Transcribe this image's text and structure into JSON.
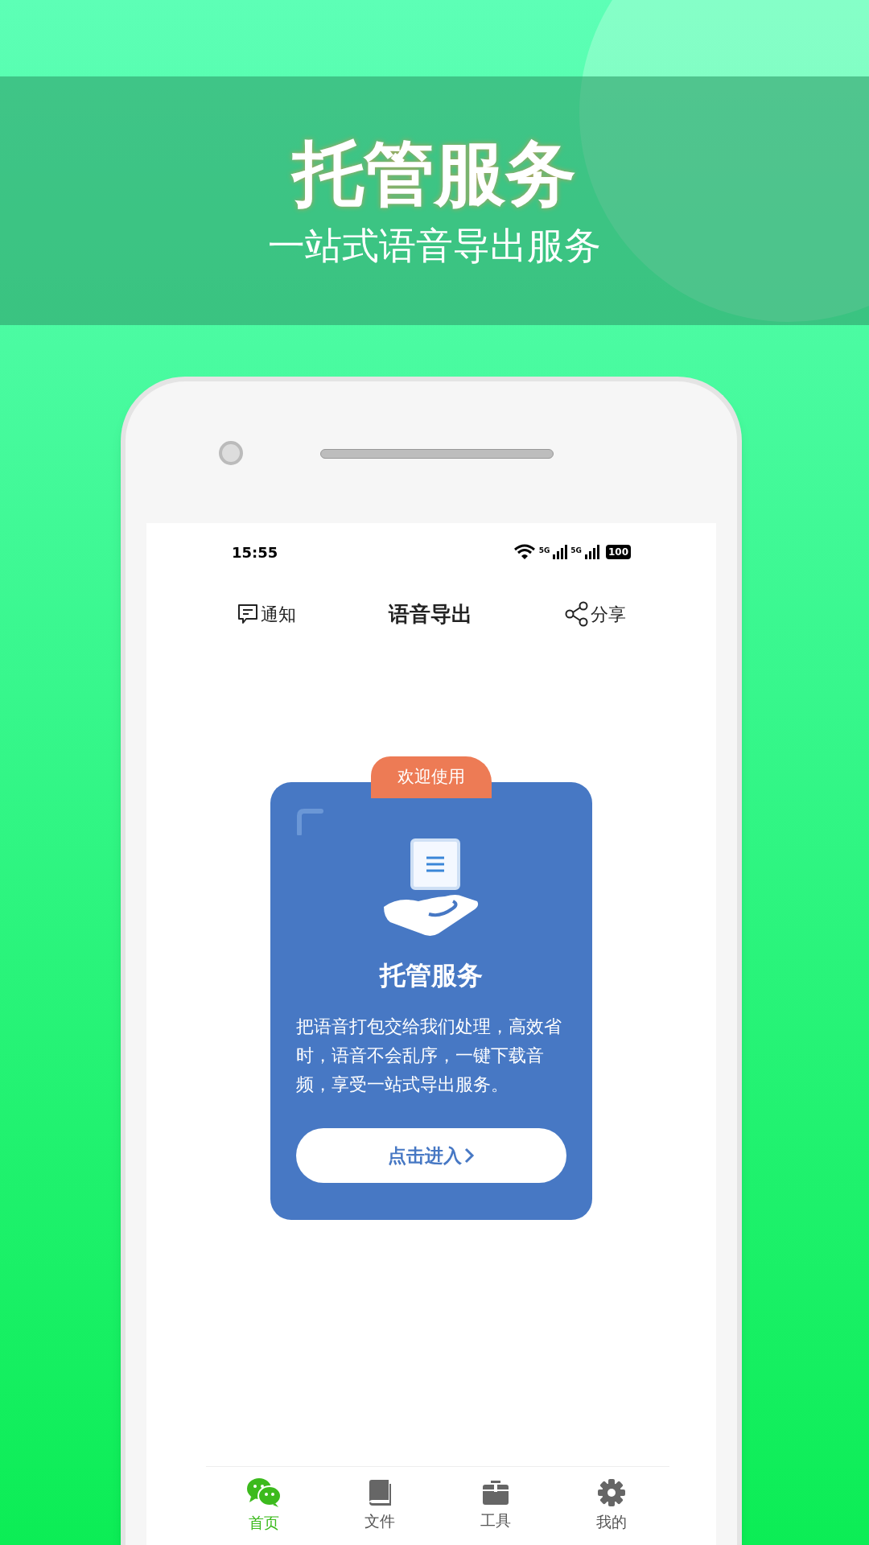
{
  "banner": {
    "title": "托管服务",
    "subtitle": "一站式语音导出服务"
  },
  "status_bar": {
    "time": "15:55",
    "signals": [
      "5G",
      "5G"
    ],
    "battery": "100"
  },
  "nav": {
    "left": "通知",
    "title": "语音导出",
    "right": "分享"
  },
  "card": {
    "badge": "欢迎使用",
    "title": "托管服务",
    "description": "把语音打包交给我们处理，高效省时，语音不会乱序，一键下载音频，享受一站式导出服务。",
    "button": "点击进入"
  },
  "tabs": [
    {
      "label": "首页",
      "kind": "chat",
      "selected": true
    },
    {
      "label": "文件",
      "kind": "book",
      "selected": false
    },
    {
      "label": "工具",
      "kind": "toolbox",
      "selected": false
    },
    {
      "label": "我的",
      "kind": "gear",
      "selected": false
    }
  ]
}
